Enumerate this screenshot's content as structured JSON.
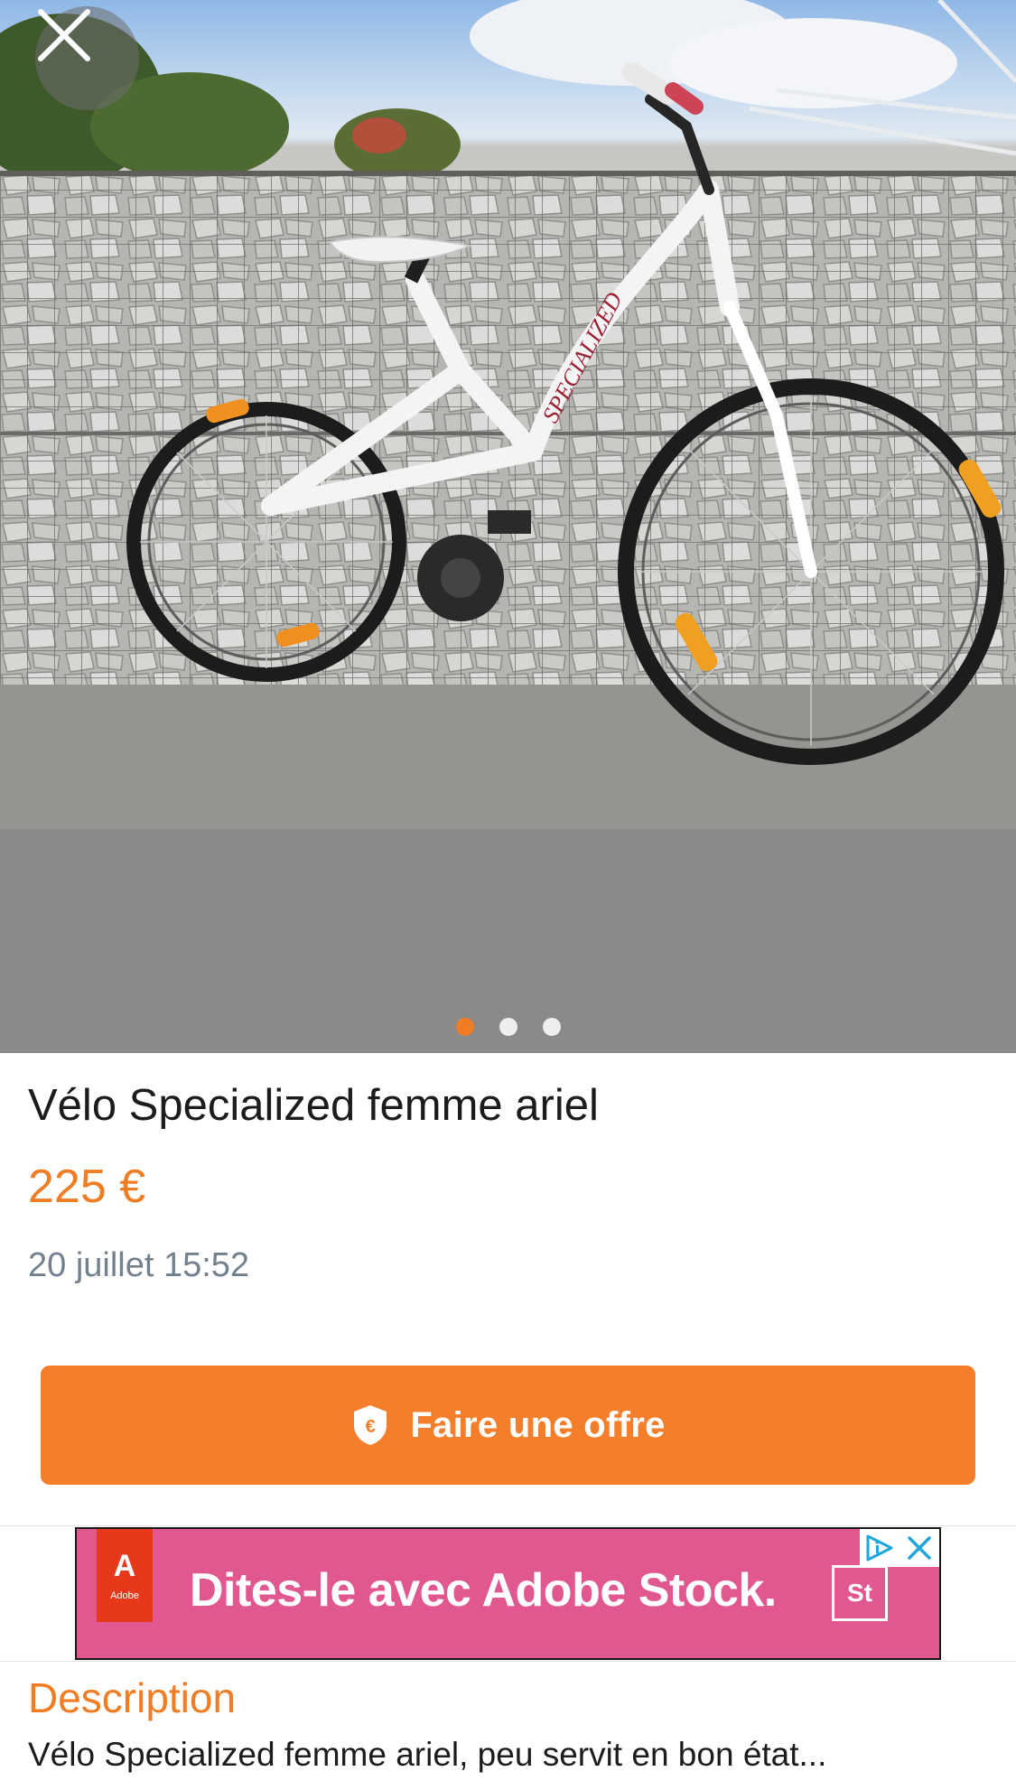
{
  "gallery": {
    "photo_count": 3,
    "active_index": 0,
    "photo_subject": "bicycle-photo",
    "close_icon": "close-icon"
  },
  "listing": {
    "title": "Vélo Specialized femme ariel",
    "price": "225 €",
    "date": "20 juillet 15:52"
  },
  "offer_button": {
    "label": "Faire une offre",
    "icon": "euro-shield-icon"
  },
  "ad": {
    "brand_logo_letter": "A",
    "brand_logo_word": "Adobe",
    "headline": "Dites-le avec Adobe Stock.",
    "product_badge": "St",
    "adchoices_icon": "adchoices-icon",
    "close_icon": "close-icon"
  },
  "description": {
    "heading": "Description",
    "text": "Vélo Specialized femme ariel, peu servit en bon état..."
  },
  "colors": {
    "accent": "#f07d23",
    "button": "#f57e2a",
    "ad_background": "#e0588f",
    "date_gray": "#73808d"
  }
}
